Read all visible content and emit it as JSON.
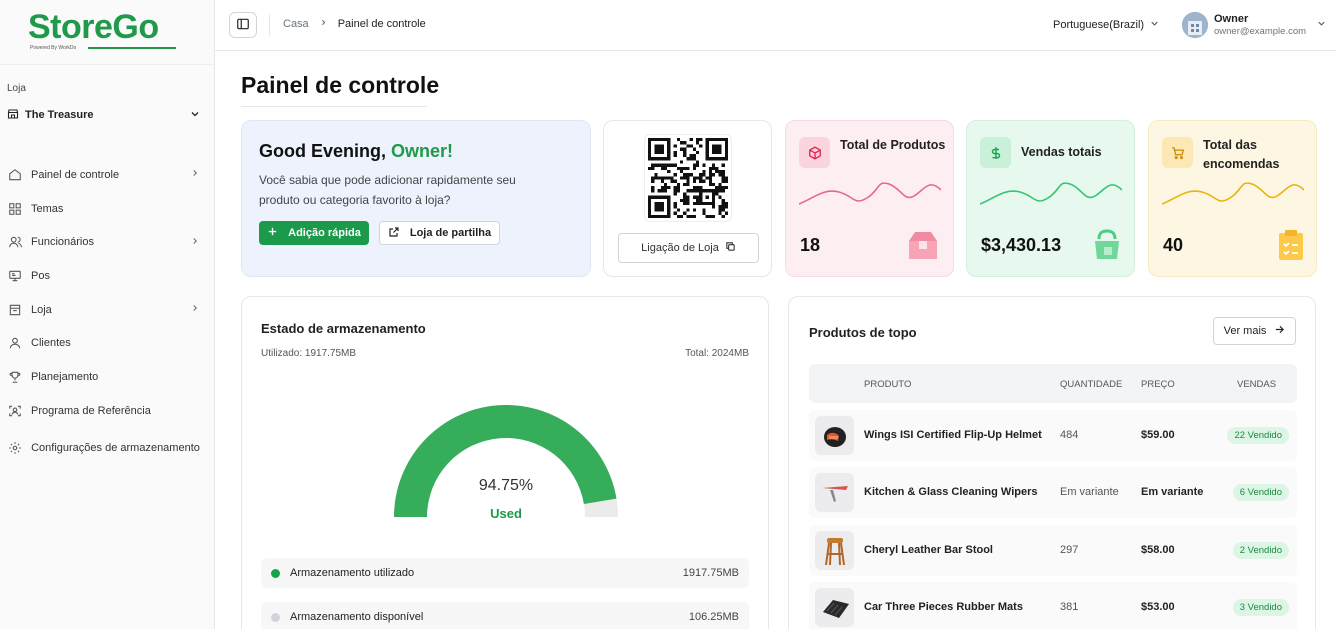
{
  "brand": {
    "name": "StoreGo",
    "tagline": "Powered By WorkDo"
  },
  "sidebar": {
    "store_label": "Loja",
    "store_name": "The Treasure",
    "items": [
      {
        "label": "Painel de controle",
        "icon": "dashboard-icon",
        "chevron": true
      },
      {
        "label": "Temas",
        "icon": "grid-icon",
        "chevron": false
      },
      {
        "label": "Funcionários",
        "icon": "users-icon",
        "chevron": true
      },
      {
        "label": "Pos",
        "icon": "pos-icon",
        "chevron": false
      },
      {
        "label": "Loja",
        "icon": "store-icon",
        "chevron": true
      },
      {
        "label": "Clientes",
        "icon": "user-icon",
        "chevron": false
      },
      {
        "label": "Planejamento",
        "icon": "trophy-icon",
        "chevron": false
      },
      {
        "label": "Programa de Referência",
        "icon": "referral-icon",
        "chevron": false
      },
      {
        "label": "Configurações de armazenamento",
        "icon": "gear-icon",
        "chevron": false
      }
    ]
  },
  "header": {
    "breadcrumb": [
      "Casa",
      "Painel de controle"
    ],
    "language": "Portuguese(Brazil)",
    "user_name": "Owner",
    "user_email": "owner@example.com"
  },
  "page_title": "Painel de controle",
  "greeting": {
    "prefix": "Good Evening, ",
    "name": "Owner!",
    "text": "Você sabia que pode adicionar rapidamente seu produto ou categoria favorito à loja?",
    "quick_add": "Adição rápida",
    "share_store": "Loja de partilha"
  },
  "qr": {
    "link_label": "Ligação de Loja"
  },
  "stats": [
    {
      "title": "Total de Produtos",
      "value": "18",
      "color": "#e11d48"
    },
    {
      "title": "Vendas totais",
      "value": "$3,430.13",
      "color": "#16a34a"
    },
    {
      "title": "Total das encomendas",
      "value": "40",
      "color": "#eab308"
    }
  ],
  "storage": {
    "title": "Estado de armazenamento",
    "used": "Utilizado: 1917.75MB",
    "total": "Total: 2024MB",
    "percent": "94.75%",
    "percent_value": 94.75,
    "used_label": "Used",
    "legend": [
      {
        "label": "Armazenamento utilizado",
        "value": "1917.75MB",
        "color": "#16a34a"
      },
      {
        "label": "Armazenamento disponível",
        "value": "106.25MB",
        "color": "#d1d5db"
      }
    ]
  },
  "top_products": {
    "title": "Produtos de topo",
    "see_more": "Ver mais",
    "columns": [
      "PRODUTO",
      "QUANTIDADE",
      "PREÇO",
      "VENDAS"
    ],
    "rows": [
      {
        "name": "Wings ISI Certified Flip-Up Helmet",
        "qty": "484",
        "price": "$59.00",
        "sold": "22 Vendido"
      },
      {
        "name": "Kitchen & Glass Cleaning Wipers",
        "qty": "Em variante",
        "price": "Em variante",
        "sold": "6 Vendido"
      },
      {
        "name": "Cheryl Leather Bar Stool",
        "qty": "297",
        "price": "$58.00",
        "sold": "2 Vendido"
      },
      {
        "name": "Car Three Pieces Rubber Mats",
        "qty": "381",
        "price": "$53.00",
        "sold": "3 Vendido"
      }
    ]
  },
  "colors": {
    "accent": "#1a9a4a"
  }
}
